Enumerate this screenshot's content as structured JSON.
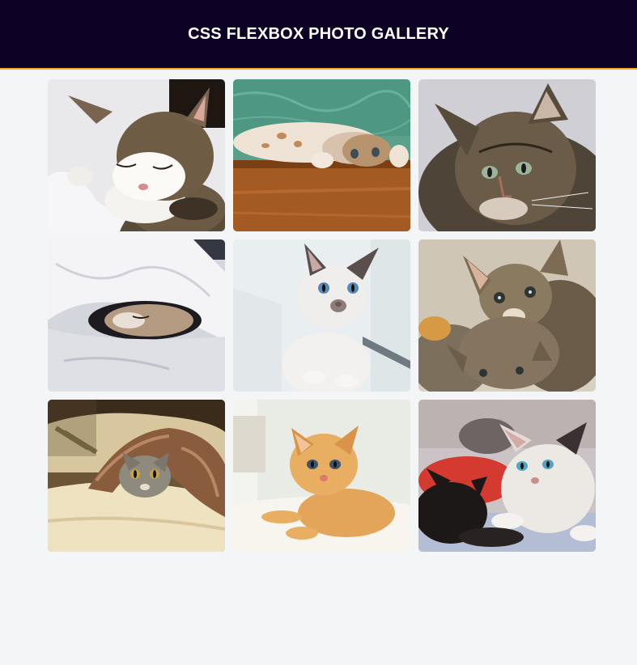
{
  "header": {
    "title": "CSS FLEXBOX PHOTO GALLERY",
    "background": "#0d0225",
    "accent": "#f5a623"
  },
  "gallery": {
    "photos": [
      {
        "subject": "sleeping tabby-and-white cat on white bedding"
      },
      {
        "subject": "cream kitten lying upside down on wooden floor with green wall"
      },
      {
        "subject": "long-haired tabby cat close-up portrait"
      },
      {
        "subject": "kitten sleeping under white duvet"
      },
      {
        "subject": "white siamese kitten with blue eyes by window"
      },
      {
        "subject": "two tabby kittens looking at camera"
      },
      {
        "subject": "grey tabby kitten hiding under brown shaggy blanket on pillow"
      },
      {
        "subject": "orange kitten lying on white surface"
      },
      {
        "subject": "black kitten and white-calico kitten lying together"
      }
    ]
  }
}
